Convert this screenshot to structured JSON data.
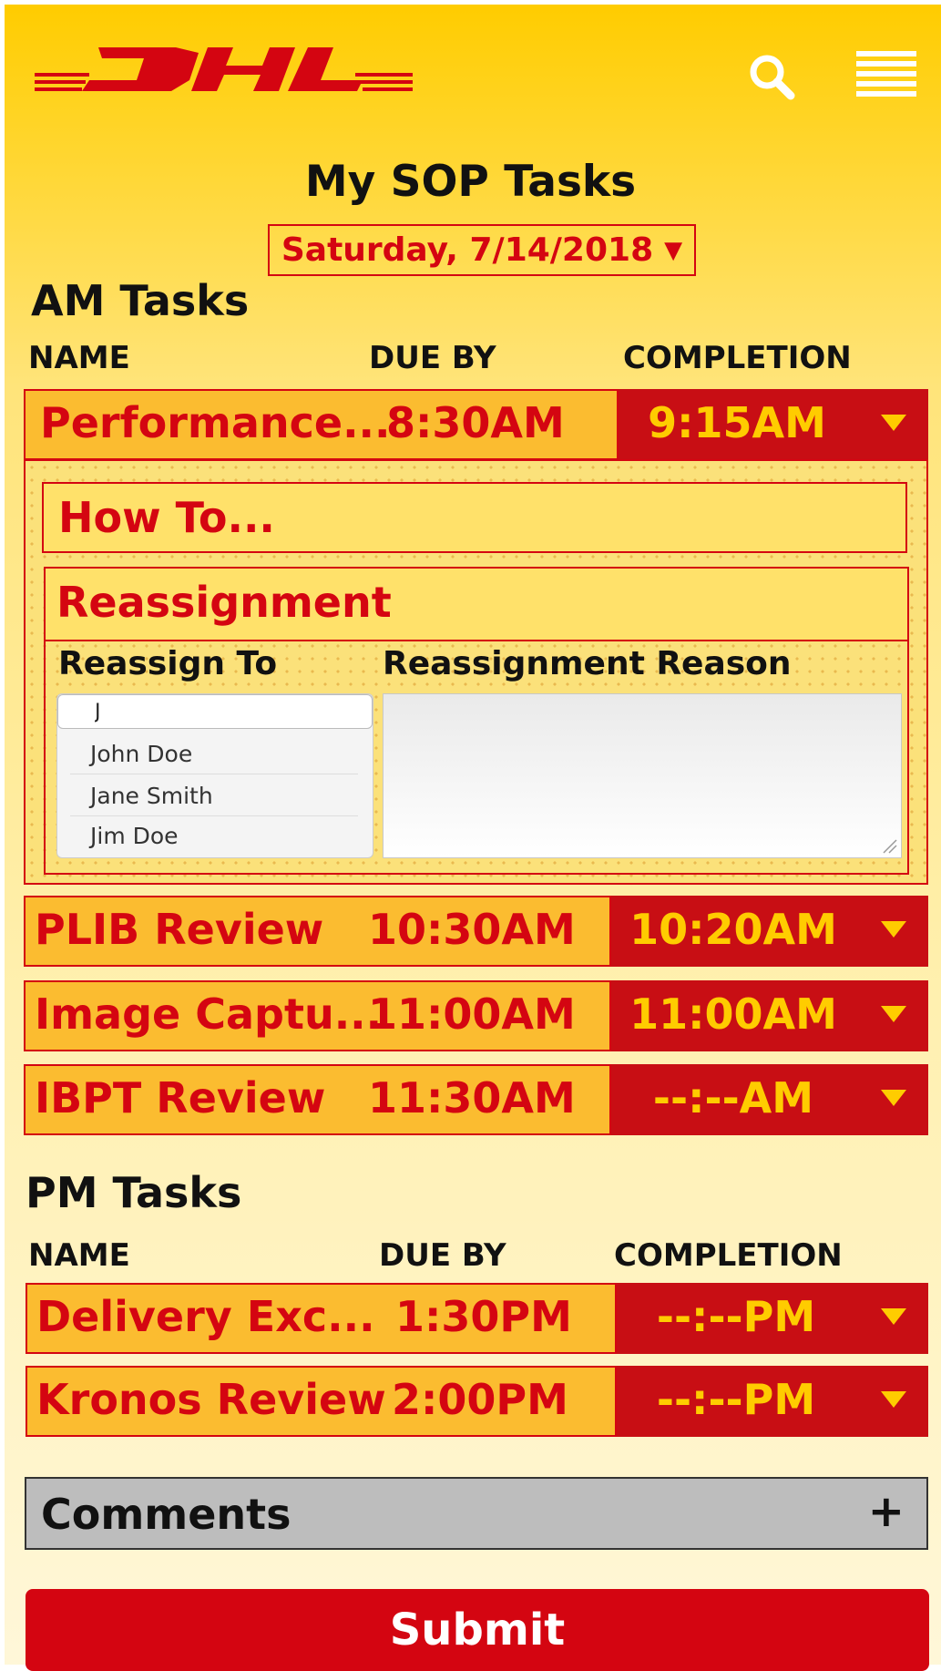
{
  "header": {
    "logo_text": "DHL",
    "search_icon": "search-icon",
    "menu_icon": "hamburger-menu-icon"
  },
  "page_title": "My SOP Tasks",
  "date_picker": {
    "value": "Saturday, 7/14/2018",
    "caret": "▼"
  },
  "am": {
    "title": "AM Tasks",
    "columns": [
      "NAME",
      "DUE BY",
      "COMPLETION"
    ],
    "tasks": [
      {
        "name": "Performance...",
        "due": "8:30AM",
        "completion": "9:15AM"
      },
      {
        "name": "PLIB Review",
        "due": "10:30AM",
        "completion": "10:20AM"
      },
      {
        "name": "Image Captu...",
        "due": "11:00AM",
        "completion": "11:00AM"
      },
      {
        "name": "IBPT Review",
        "due": "11:30AM",
        "completion": "--:--AM"
      }
    ]
  },
  "expanded": {
    "how_to": "How To...",
    "reassignment": {
      "title": "Reassignment",
      "reassign_to_label": "Reassign To",
      "reason_label": "Reassignment Reason",
      "search_value": "J",
      "options": [
        "John Doe",
        "Jane Smith",
        "Jim Doe"
      ]
    }
  },
  "pm": {
    "title": "PM Tasks",
    "columns": [
      "NAME",
      "DUE BY",
      "COMPLETION"
    ],
    "tasks": [
      {
        "name": "Delivery Exc...",
        "due": "1:30PM",
        "completion": "--:--PM"
      },
      {
        "name": "Kronos Review",
        "due": "2:00PM",
        "completion": "--:--PM"
      }
    ]
  },
  "comments": {
    "label": "Comments",
    "toggle": "+"
  },
  "submit_label": "Submit",
  "colors": {
    "dhl_yellow": "#ffcc00",
    "dhl_red": "#d40511",
    "row_yellow": "#fbbc30",
    "completion_red": "#c80e14",
    "comments_gray": "#bdbdbd"
  }
}
